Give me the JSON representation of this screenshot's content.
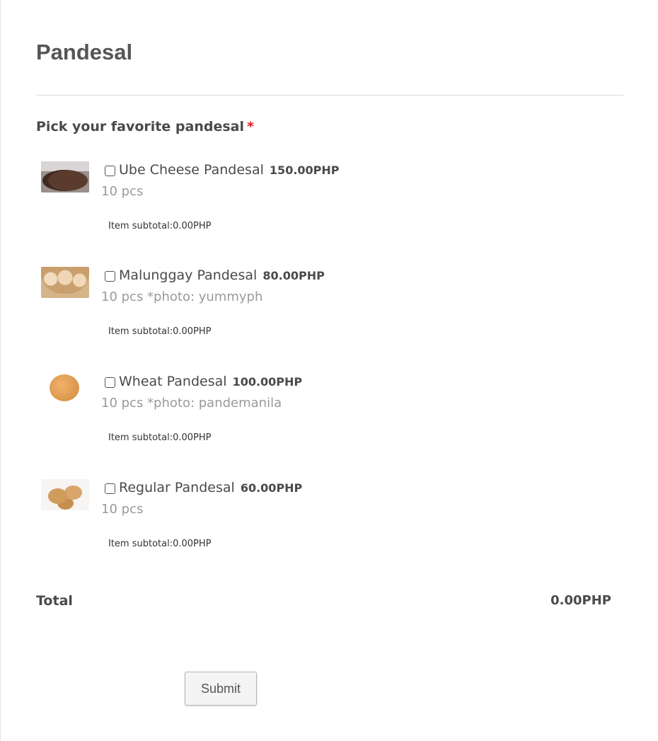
{
  "form": {
    "title": "Pandesal",
    "question": "Pick your favorite pandesal",
    "required_marker": "*"
  },
  "products": [
    {
      "name": "Ube Cheese Pandesal",
      "price": "150.00PHP",
      "description": "10 pcs",
      "subtotal": "Item subtotal:0.00PHP",
      "checked": false
    },
    {
      "name": "Malunggay Pandesal",
      "price": "80.00PHP",
      "description": "10 pcs *photo: yummyph",
      "subtotal": "Item subtotal:0.00PHP",
      "checked": false
    },
    {
      "name": "Wheat Pandesal",
      "price": "100.00PHP",
      "description": "10 pcs *photo: pandemanila",
      "subtotal": "Item subtotal:0.00PHP",
      "checked": false
    },
    {
      "name": "Regular Pandesal",
      "price": "60.00PHP",
      "description": "10 pcs",
      "subtotal": "Item subtotal:0.00PHP",
      "checked": false
    }
  ],
  "total": {
    "label": "Total",
    "value": "0.00PHP"
  },
  "submit_label": "Submit",
  "colors": {
    "required": "#e01b1b",
    "text": "#4a4a4a",
    "muted": "#9a9a9a"
  }
}
